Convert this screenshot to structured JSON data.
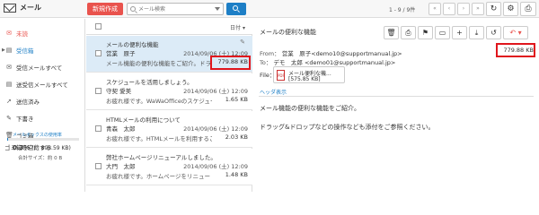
{
  "app": {
    "title": "メール"
  },
  "toolbar": {
    "new_label": "新規作成",
    "search_placeholder": "メール検索",
    "paging": "1 - 9 / 9件",
    "nav": [
      "«",
      "‹",
      "›",
      "»"
    ],
    "right_icons": [
      "refresh-icon",
      "gear-icon",
      "print-icon"
    ]
  },
  "sidebar": {
    "folders": [
      {
        "label": "未読",
        "icon": "mail-icon"
      },
      {
        "label": "受信箱",
        "icon": "inbox-icon"
      },
      {
        "label": "受信メールすべて",
        "icon": "mail-icon"
      },
      {
        "label": "送受信メールすべて",
        "icon": "inbox-icon"
      },
      {
        "label": "送信済み",
        "icon": "send-icon"
      },
      {
        "label": "下書き",
        "icon": "pencil-icon"
      },
      {
        "label": "ゴミ箱",
        "icon": "trash-icon"
      },
      {
        "label": "ゴミ箱を空にする",
        "icon": ""
      }
    ],
    "usage_label": "メールボックスの使用率",
    "usage_percent": "0.3%",
    "usage_of": "(約 808.59 KB)",
    "usage_fraction": 0.003,
    "total_size": "合計サイズ：約 0 B"
  },
  "list": {
    "sort_label": "日付",
    "messages": [
      {
        "subject": "メールの便利な機能",
        "from": "営業　原子",
        "date": "2014/09/06 (土) 12:09",
        "preview": "メール機能の便利な機能をご紹介。ドラ",
        "size": "779.88 KB",
        "has_attachment": true,
        "selected": true
      },
      {
        "subject": "スケジュールを活用しましょう。",
        "from": "守契 愛美",
        "date": "2014/09/06 (土) 12:09",
        "preview": "お疲れ様です。WaWaOfficeのスケジュー",
        "size": "1.65 KB",
        "has_attachment": false,
        "selected": false
      },
      {
        "subject": "HTMLメールの利用について",
        "from": "青森　太郎",
        "date": "2014/09/06 (土) 12:09",
        "preview": "お疲れ様です。HTMLメールを利用するこ",
        "size": "2.03 KB",
        "has_attachment": false,
        "selected": false
      },
      {
        "subject": "弊社ホームページリニューアルしました。",
        "from": "大門　太郎",
        "date": "2014/09/06 (土) 12:09",
        "preview": "お疲れ様です。ホームページをリニュー",
        "size": "1.48 KB",
        "has_attachment": false,
        "selected": false
      }
    ]
  },
  "reader": {
    "subject": "メールの便利な機能",
    "from_label": "From：",
    "from_value": "営業　原子<demo10@supportmanual.jp>",
    "to_label": "To：",
    "to_value": "デモ　太郎 <demo01@supportmanual.jp>",
    "file_label": "File：",
    "size": "779.88 KB",
    "attachment_name": "メール便利な機...",
    "attachment_size": "[575.85 KB]",
    "header_link": "ヘッダ表示",
    "body": [
      "メール機能の便利な機能をご紹介。",
      "ドラッグ&ドロップなどの操作なども添付をご参照ください。"
    ],
    "tools": [
      "trash-icon",
      "print-icon",
      "flag-icon",
      "folder-icon",
      "plus-icon",
      "download-icon",
      "history-icon",
      "reply-icon"
    ]
  },
  "colors": {
    "accent": "#e9534d",
    "primary": "#1e7fc6",
    "selected": "#dcebf7",
    "highlight": "#e0161d"
  }
}
